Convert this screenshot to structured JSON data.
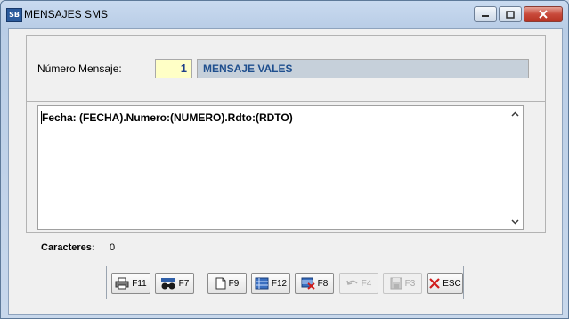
{
  "window": {
    "icon_text": "SB",
    "title": "MENSAJES SMS"
  },
  "form": {
    "numero_label": "Número Mensaje:",
    "numero_value": "1",
    "mensaje_name": "MENSAJE VALES",
    "body_text": "Fecha: (FECHA).Numero:(NUMERO).Rdto:(RDTO)",
    "caracteres_label": "Caracteres:",
    "caracteres_value": "0"
  },
  "toolbar": {
    "buttons": [
      {
        "key": "F11",
        "icon": "printer-icon",
        "enabled": true
      },
      {
        "key": "F7",
        "icon": "search-binoculars-icon",
        "enabled": true
      },
      {
        "key": "F9",
        "icon": "new-document-icon",
        "enabled": true
      },
      {
        "key": "F12",
        "icon": "edit-record-icon",
        "enabled": true
      },
      {
        "key": "F8",
        "icon": "delete-record-icon",
        "enabled": true
      },
      {
        "key": "F4",
        "icon": "undo-icon",
        "enabled": false
      },
      {
        "key": "F3",
        "icon": "save-disk-icon",
        "enabled": false
      },
      {
        "key": "ESC",
        "icon": "exit-x-icon",
        "enabled": true
      }
    ]
  },
  "colors": {
    "accent_text": "#1f4f8e",
    "number_field_bg": "#ffffc6",
    "name_field_bg": "#c6d0da",
    "close_red": "#c8493a",
    "exit_red": "#d01c1c"
  }
}
